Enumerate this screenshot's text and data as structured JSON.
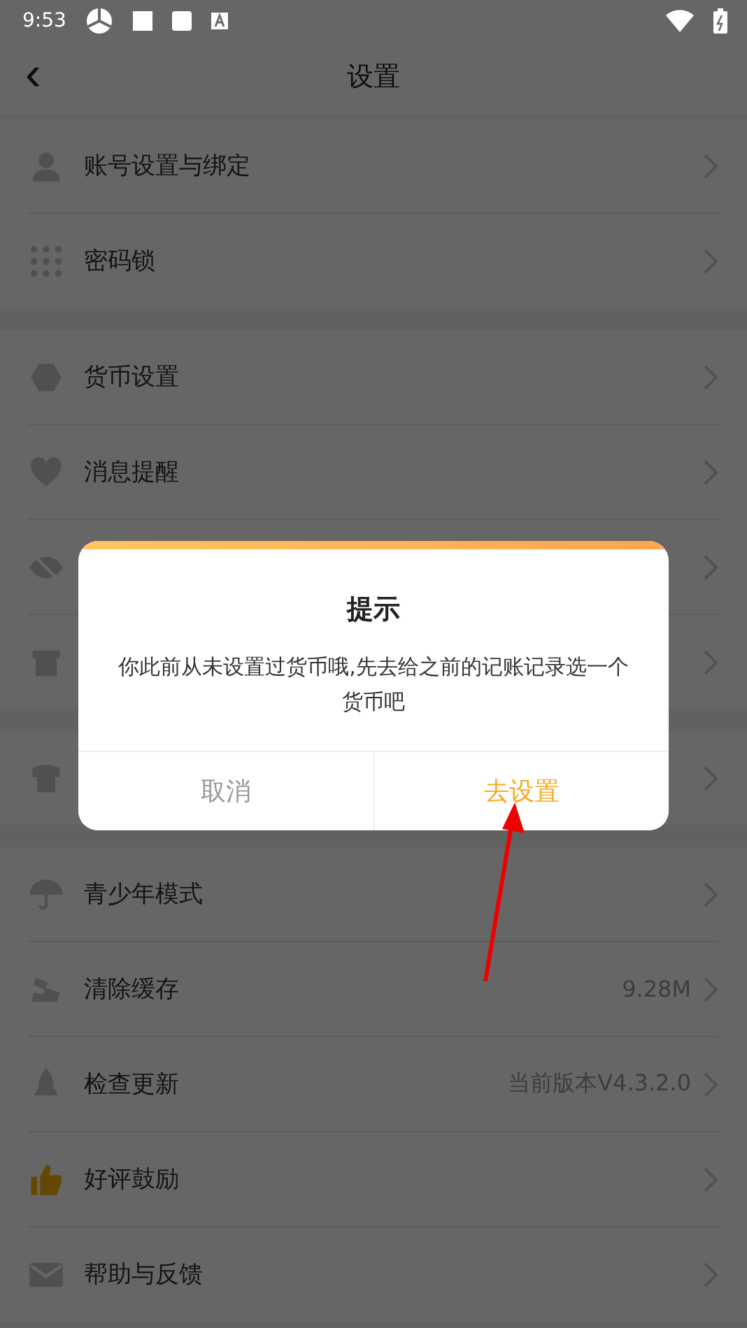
{
  "status_bar": {
    "time": "9:53"
  },
  "header": {
    "back": "‹",
    "title": "设置"
  },
  "sections": [
    {
      "rows": [
        {
          "label": "账号设置与绑定"
        },
        {
          "label": "密码锁"
        }
      ]
    },
    {
      "rows": [
        {
          "label": "货币设置"
        },
        {
          "label": "消息提醒"
        },
        {},
        {}
      ]
    },
    {
      "rows": [
        {}
      ]
    },
    {
      "rows": [
        {
          "label": "青少年模式"
        },
        {
          "label": "清除缓存",
          "value": "9.28M"
        },
        {
          "label": "检查更新",
          "value": "当前版本V4.3.2.0"
        },
        {
          "label": "好评鼓励"
        },
        {
          "label": "帮助与反馈"
        }
      ]
    }
  ],
  "dialog": {
    "title": "提示",
    "message": "你此前从未设置过货币哦,先去给之前的记账记录选一个货币吧",
    "buttons": [
      {
        "label": "取消",
        "kind": "cancel"
      },
      {
        "label": "去设置",
        "kind": "confirm"
      }
    ]
  }
}
